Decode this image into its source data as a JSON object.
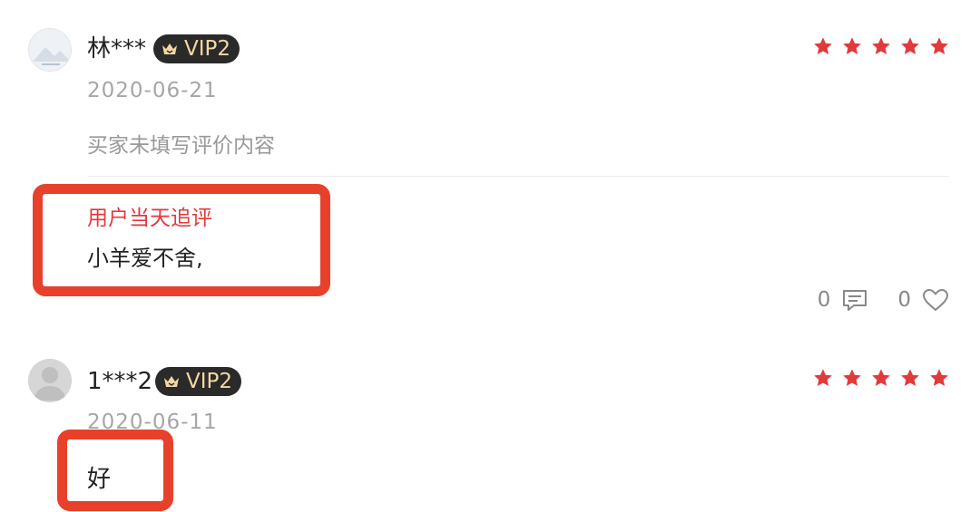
{
  "reviews": [
    {
      "username": "林***",
      "vip": "VIP2",
      "rating": 5,
      "date": "2020-06-21",
      "content": "买家未填写评价内容",
      "followup": {
        "title": "用户当天追评",
        "text": "小羊爱不舍,"
      },
      "comment_count": "0",
      "like_count": "0"
    },
    {
      "username": "1***2",
      "vip": "VIP2",
      "rating": 5,
      "date": "2020-06-11",
      "content": "好"
    }
  ],
  "colors": {
    "star": "#e2393b",
    "highlight": "#e8412b",
    "vip_bg": "#2a2a2a",
    "vip_text": "#f4d7a0"
  },
  "icons": [
    "crown-icon",
    "star-icon",
    "comment-icon",
    "heart-icon"
  ]
}
